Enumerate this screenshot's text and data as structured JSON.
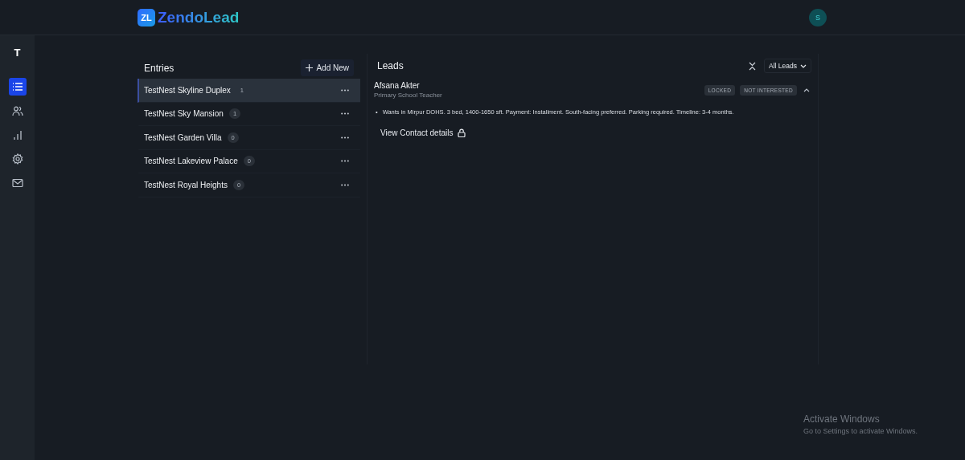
{
  "header": {
    "logo_mark": "ZL",
    "logo_text": "ZendoLead",
    "avatar": "S"
  },
  "sidebar": {
    "brand_letter": "T",
    "items": [
      {
        "kind": "list",
        "selected": true
      },
      {
        "kind": "users",
        "selected": false
      },
      {
        "kind": "chart",
        "selected": false
      },
      {
        "kind": "settings",
        "selected": false
      },
      {
        "kind": "mail",
        "selected": false
      }
    ]
  },
  "entries": {
    "title": "Entries",
    "add_button": "Add New",
    "items": [
      {
        "name": "TestNest Skyline Duplex",
        "count": "1",
        "selected": true
      },
      {
        "name": "TestNest Sky Mansion",
        "count": "1",
        "selected": false
      },
      {
        "name": "TestNest Garden Villa",
        "count": "0",
        "selected": false
      },
      {
        "name": "TestNest Lakeview Palace",
        "count": "0",
        "selected": false
      },
      {
        "name": "TestNest Royal Heights",
        "count": "0",
        "selected": false
      }
    ]
  },
  "leads": {
    "title": "Leads",
    "filter": "All Leads",
    "items": [
      {
        "name": "Afsana Akter",
        "role": "Primary School Teacher",
        "tags": [
          "LOCKED",
          "NOT INTERESTED"
        ],
        "expanded": true,
        "note_marker": "•",
        "notes": [
          "Wants in Mirpur DOHS. 3 bed, 1400-1650 sft. Payment: Installment. South-facing preferred. Parking required. Timeline: 3-4 months."
        ],
        "contact_link": "View Contact details"
      }
    ]
  },
  "os_overlay": {
    "title": "Activate Windows",
    "subtitle": "Go to Settings to activate Windows."
  }
}
